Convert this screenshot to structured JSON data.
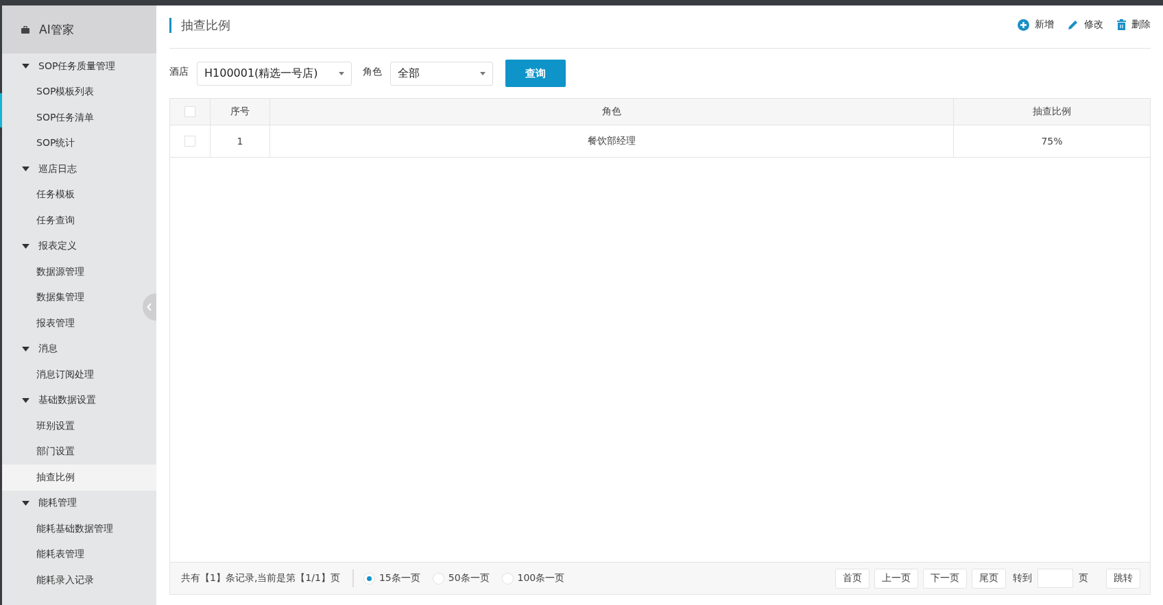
{
  "sidebar": {
    "title": "AI管家",
    "groups": [
      {
        "label": "SOP任务质量管理",
        "expanded": true,
        "children": [
          {
            "label": "SOP模板列表",
            "selected": false
          },
          {
            "label": "SOP任务清单",
            "selected": false
          },
          {
            "label": "SOP统计",
            "selected": false
          }
        ]
      },
      {
        "label": "巡店日志",
        "expanded": true,
        "children": [
          {
            "label": "任务模板",
            "selected": false
          },
          {
            "label": "任务查询",
            "selected": false
          }
        ]
      },
      {
        "label": "报表定义",
        "expanded": true,
        "children": [
          {
            "label": "数据源管理",
            "selected": false
          },
          {
            "label": "数据集管理",
            "selected": false
          },
          {
            "label": "报表管理",
            "selected": false
          }
        ]
      },
      {
        "label": "消息",
        "expanded": true,
        "children": [
          {
            "label": "消息订阅处理",
            "selected": false
          }
        ]
      },
      {
        "label": "基础数据设置",
        "expanded": true,
        "children": [
          {
            "label": "班别设置",
            "selected": false
          },
          {
            "label": "部门设置",
            "selected": false
          },
          {
            "label": "抽查比例",
            "selected": true
          }
        ]
      },
      {
        "label": "能耗管理",
        "expanded": true,
        "children": [
          {
            "label": "能耗基础数据管理",
            "selected": false
          },
          {
            "label": "能耗表管理",
            "selected": false
          },
          {
            "label": "能耗录入记录",
            "selected": false
          }
        ]
      }
    ]
  },
  "page_title": "抽查比例",
  "actions": [
    {
      "kind": "add",
      "label": "新增"
    },
    {
      "kind": "edit",
      "label": "修改"
    },
    {
      "kind": "delete",
      "label": "删除"
    }
  ],
  "filters": {
    "hotel_label": "酒店",
    "hotel_value": "H100001(精选一号店)",
    "role_label": "角色",
    "role_value": "全部",
    "query_button": "查询"
  },
  "table": {
    "select_all_checked": false,
    "columns": [
      "序号",
      "角色",
      "抽查比例"
    ],
    "rows": [
      {
        "checked": false,
        "cells": [
          "1",
          "餐饮部经理",
          "75%"
        ]
      }
    ]
  },
  "footer": {
    "summary": "共有【1】条记录,当前是第【1/1】页",
    "page_sizes": [
      {
        "label": "15条一页",
        "selected": true
      },
      {
        "label": "50条一页",
        "selected": false
      },
      {
        "label": "100条一页",
        "selected": false
      }
    ],
    "nav_buttons": [
      "首页",
      "上一页",
      "下一页",
      "尾页"
    ],
    "goto_label": "转到",
    "goto_unit": "页",
    "jump_button": "跳转"
  }
}
